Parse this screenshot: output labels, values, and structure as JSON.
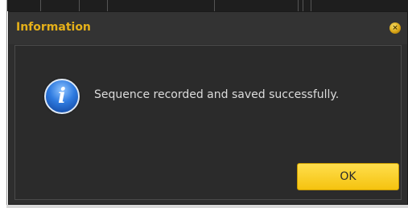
{
  "dialog": {
    "title": "Information",
    "message": "Sequence recorded and saved successfully.",
    "ok_label": "OK",
    "close_glyph": "×"
  },
  "icons": {
    "info": "info-icon",
    "close": "close-icon",
    "info_glyph": "i"
  },
  "colors": {
    "title": "#e5b019",
    "ok_button": "#f5c30f",
    "dialog_bg": "#2e2e2e",
    "message_text": "#dcdcdc"
  }
}
